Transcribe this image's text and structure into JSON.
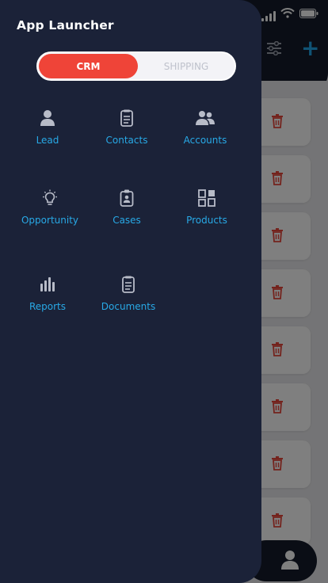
{
  "drawer": {
    "title": "App Launcher",
    "tabs": [
      {
        "label": "CRM",
        "active": true
      },
      {
        "label": "SHIPPING",
        "active": false
      }
    ],
    "items": [
      {
        "label": "Lead",
        "icon": "person-icon"
      },
      {
        "label": "Contacts",
        "icon": "clipboard-icon"
      },
      {
        "label": "Accounts",
        "icon": "people-icon"
      },
      {
        "label": "Opportunity",
        "icon": "lightbulb-icon"
      },
      {
        "label": "Cases",
        "icon": "badge-icon"
      },
      {
        "label": "Products",
        "icon": "grid-icon"
      },
      {
        "label": "Reports",
        "icon": "bar-chart-icon"
      },
      {
        "label": "Documents",
        "icon": "document-icon"
      }
    ]
  },
  "colors": {
    "drawer_bg": "#1b2238",
    "accent_red": "#ef4438",
    "link_blue": "#28a9e6",
    "icon_gray": "#b8bcc8"
  }
}
